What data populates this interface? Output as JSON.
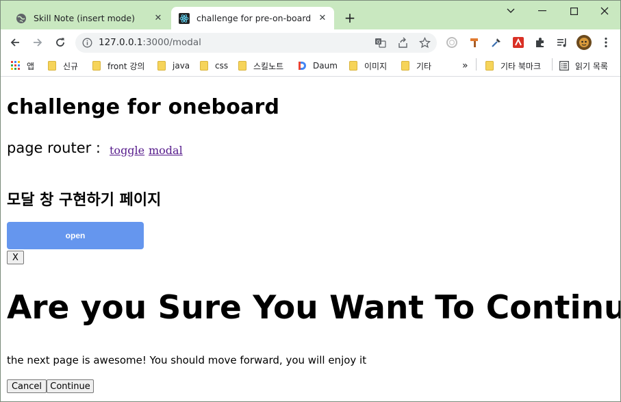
{
  "browser": {
    "tabs": [
      {
        "title": "Skill Note (insert mode)",
        "icon": "globe-icon",
        "active": false
      },
      {
        "title": "challenge for pre-on-board",
        "icon": "react-icon",
        "active": true
      }
    ],
    "new_tab": "+",
    "url_host": "127.0.0.1",
    "url_rest": ":3000/modal",
    "bookmarks": [
      {
        "label": "앱",
        "icon": "apps-grid-icon"
      },
      {
        "label": "신규",
        "icon": "folder-icon"
      },
      {
        "label": "front 강의",
        "icon": "folder-icon"
      },
      {
        "label": "java",
        "icon": "folder-icon"
      },
      {
        "label": "css",
        "icon": "folder-icon"
      },
      {
        "label": "스킬노트",
        "icon": "folder-icon"
      },
      {
        "label": "Daum",
        "icon": "daum-icon"
      },
      {
        "label": "이미지",
        "icon": "folder-icon"
      },
      {
        "label": "기타",
        "icon": "folder-icon"
      }
    ],
    "bookmarks_overflow": "»",
    "other_bookmarks": "기타 북마크",
    "reading_list": "읽기 목록"
  },
  "page": {
    "title": "challenge for oneboard",
    "router_label": "page router :",
    "links": [
      "toggle",
      "modal"
    ],
    "section_title": "모달 창 구현하기 페이지",
    "open_button": "open",
    "close_button": "X",
    "modal_heading": "Are you Sure You Want To Continue?",
    "modal_text": "the next page is awesome! You should move forward, you will enjoy it",
    "cancel_button": "Cancel",
    "continue_button": "Continue"
  },
  "colors": {
    "tab_strip": "#c9e8c0",
    "open_button": "#6596ee",
    "visited_link": "#551a8b"
  }
}
